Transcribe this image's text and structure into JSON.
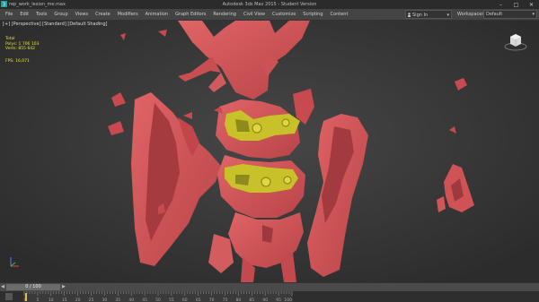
{
  "titlebar": {
    "file": "rep_work_lesion_me.max",
    "title": "Autodesk 3ds Max 2015 - Student Version",
    "controls": [
      "–",
      "□",
      "✕"
    ]
  },
  "menubar": {
    "items": [
      "File",
      "Edit",
      "Tools",
      "Group",
      "Views",
      "Create",
      "Modifiers",
      "Animation",
      "Graph Editors",
      "Rendering",
      "Civil View",
      "Customize",
      "Scripting",
      "Content"
    ],
    "signin": "Sign In",
    "workspace_label": "Workspaces:",
    "workspace_value": "Default"
  },
  "viewport": {
    "label": "[+] [Perspective] [Standard] [Default Shading]",
    "stats": {
      "header": "Total",
      "polys_label": "Polys:",
      "polys_value": "1 706 103",
      "verts_label": "Verts:",
      "verts_value": "855 642",
      "fps_label": "FPS:",
      "fps_value": "16,071"
    }
  },
  "timeline": {
    "frame_label": "0 / 100",
    "tick_labels": [
      "0",
      "5",
      "10",
      "15",
      "20",
      "25",
      "30",
      "35",
      "40",
      "45",
      "50",
      "55",
      "60",
      "65",
      "70",
      "75",
      "80",
      "85",
      "90",
      "95",
      "100"
    ]
  },
  "colors": {
    "mesh": "#d8585a",
    "mesh_dark": "#a43a3e",
    "implant": "#c9c12a",
    "viewport_bg": "#3b3b3b",
    "stats_text": "#e6e13a"
  }
}
